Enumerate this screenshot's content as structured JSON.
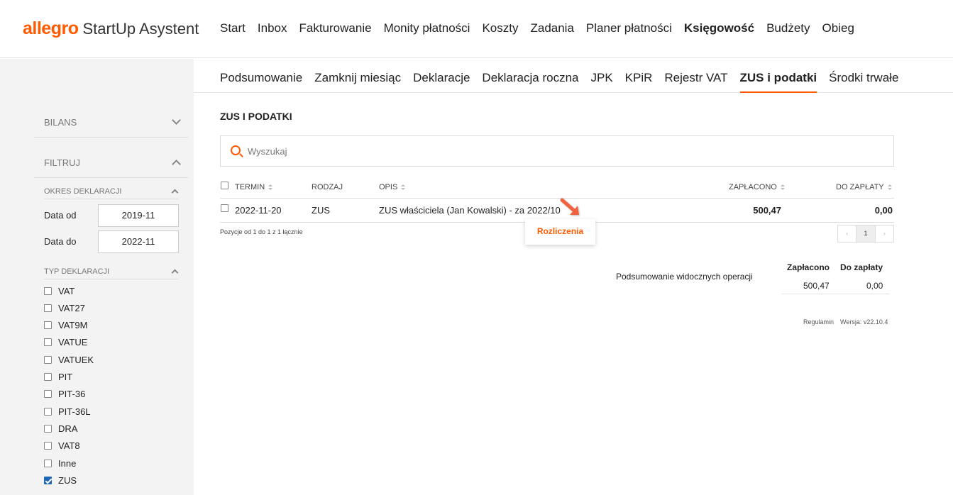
{
  "header": {
    "brand": "allegro",
    "product": "StartUp Asystent",
    "nav": [
      "Start",
      "Inbox",
      "Fakturowanie",
      "Monity płatności",
      "Koszty",
      "Zadania",
      "Planer płatności",
      "Księgowość",
      "Budżety",
      "Obieg"
    ],
    "active_nav": "Księgowość"
  },
  "sidebar": {
    "bilans": "BILANS",
    "filtruj": "FILTRUJ",
    "okres": "OKRES DEKLARACJI",
    "data_od_label": "Data od",
    "data_od_value": "2019-11",
    "data_do_label": "Data do",
    "data_do_value": "2022-11",
    "typ": "TYP DEKLARACJI",
    "types": [
      {
        "label": "VAT",
        "checked": false
      },
      {
        "label": "VAT27",
        "checked": false
      },
      {
        "label": "VAT9M",
        "checked": false
      },
      {
        "label": "VATUE",
        "checked": false
      },
      {
        "label": "VATUEK",
        "checked": false
      },
      {
        "label": "PIT",
        "checked": false
      },
      {
        "label": "PIT-36",
        "checked": false
      },
      {
        "label": "PIT-36L",
        "checked": false
      },
      {
        "label": "DRA",
        "checked": false
      },
      {
        "label": "VAT8",
        "checked": false
      },
      {
        "label": "Inne",
        "checked": false
      },
      {
        "label": "ZUS",
        "checked": true
      }
    ]
  },
  "subnav": {
    "tabs": [
      "Podsumowanie",
      "Zamknij miesiąc",
      "Deklaracje",
      "Deklaracja roczna",
      "JPK",
      "KPiR",
      "Rejestr VAT",
      "ZUS i podatki",
      "Środki trwałe"
    ],
    "active_tab": "ZUS i podatki"
  },
  "main": {
    "title": "ZUS I PODATKI",
    "search_placeholder": "Wyszukaj",
    "columns": {
      "termin": "TERMIN",
      "rodzaj": "RODZAJ",
      "opis": "OPIS",
      "zaplacono": "ZAPŁACONO",
      "do_zaplaty": "DO ZAPŁATY"
    },
    "rows": [
      {
        "termin": "2022-11-20",
        "rodzaj": "ZUS",
        "opis": "ZUS właściciela (Jan Kowalski) - za 2022/10",
        "zaplacono": "500,47",
        "do_zaplaty": "0,00"
      }
    ],
    "pager_info": "Pozycje od 1 do 1 z 1 łącznie",
    "pager": {
      "prev": "‹",
      "page": "1",
      "next": "›"
    },
    "popup_label": "Rozliczenia"
  },
  "summary": {
    "label": "Podsumowanie widocznych operacji",
    "paid_header": "Zapłacono",
    "due_header": "Do zapłaty",
    "paid_value": "500,47",
    "due_value": "0,00"
  },
  "footer": {
    "regulamin": "Regulamin",
    "version": "Wersja: v22.10.4"
  },
  "colors": {
    "accent": "#ff5a00",
    "checkbox_checked": "#1b67b6",
    "sidebar_bg": "#f3f3f3"
  }
}
